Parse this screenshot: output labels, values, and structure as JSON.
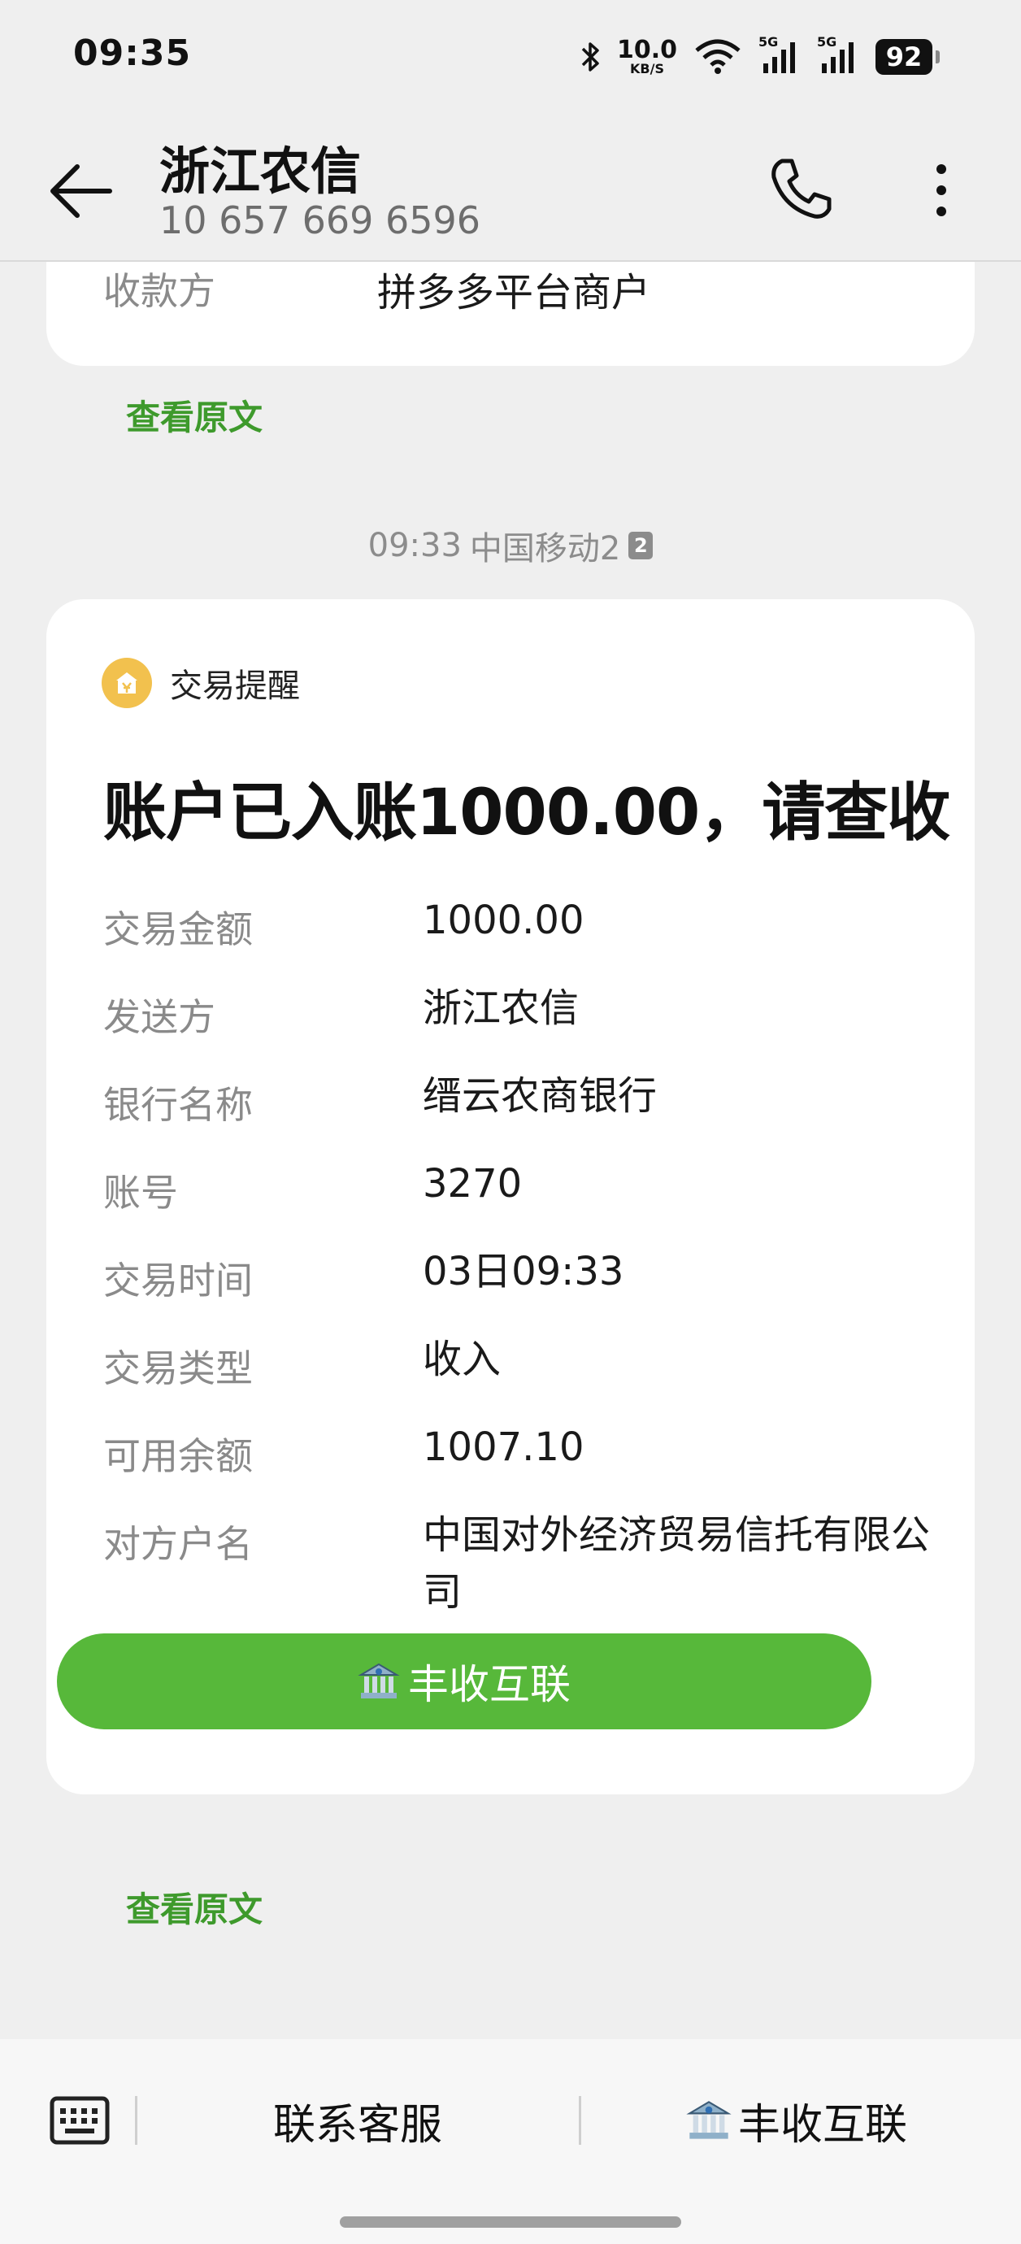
{
  "status_bar": {
    "time": "09:35",
    "net_speed_value": "10.0",
    "net_speed_unit": "KB/S",
    "signal1_label": "5G",
    "signal2_label": "5G",
    "battery": "92",
    "icons": [
      "bluetooth-icon",
      "wifi-icon",
      "signal-icon",
      "signal-icon",
      "battery-icon"
    ]
  },
  "header": {
    "title": "浙江农信",
    "subtitle": "10 657 669 6596",
    "icons": [
      "back-arrow-icon",
      "phone-icon",
      "more-vertical-icon"
    ]
  },
  "previous_message": {
    "payee_label": "收款方",
    "payee_value": "拼多多平台商户",
    "view_original": "查看原文"
  },
  "timestamp": {
    "time": "09:33",
    "carrier": "中国移动2",
    "sim_badge": "2"
  },
  "card": {
    "type": "交易提醒",
    "title": "账户已入账1000.00，请查收",
    "rows": [
      {
        "label": "交易金额",
        "value": "1000.00"
      },
      {
        "label": "发送方",
        "value": "浙江农信"
      },
      {
        "label": "银行名称",
        "value": "缙云农商银行"
      },
      {
        "label": "账号",
        "value": "3270"
      },
      {
        "label": "交易时间",
        "value": "03日09:33"
      },
      {
        "label": "交易类型",
        "value": "收入"
      },
      {
        "label": "可用余额",
        "value": "1007.10"
      },
      {
        "label": "对方户名",
        "value": "中国对外经济贸易信托有限公司"
      }
    ],
    "action_button": "丰收互联",
    "view_original": "查看原文"
  },
  "bottom_bar": {
    "contact_service": "联系客服",
    "fengshou": "丰收互联",
    "icons": [
      "keyboard-icon",
      "bank-icon"
    ]
  },
  "colors": {
    "accent_green": "#57b83a",
    "link_green": "#3e9a2c",
    "coin_yellow": "#f2c14e"
  }
}
